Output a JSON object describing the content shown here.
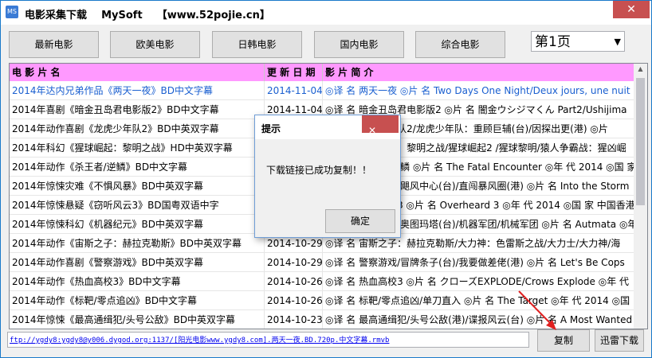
{
  "window": {
    "title": "电影采集下载    MySoft    【www.52pojie.cn】",
    "icon": "MS"
  },
  "nav": {
    "latest": "最新电影",
    "western": "欧美电影",
    "japan_korea": "日韩电影",
    "domestic": "国内电影",
    "general": "综合电影",
    "page": "第1页"
  },
  "table": {
    "columns": [
      "电 影 片 名",
      "更 新 日 期",
      "影 片 简 介"
    ],
    "rows": [
      [
        "2014年达内兄弟作品《两天一夜》BD中文字幕",
        "2014-11-04",
        "◎译 名 两天一夜 ◎片 名 Two Days One Night/Deux jours, une nuit"
      ],
      [
        "2014年喜剧《暗金丑岛君电影版2》BD中文字幕",
        "2014-11-04",
        "◎译 名 暗金丑岛君电影版2 ◎片 名 闇金ウシジマくん Part2/Ushijima"
      ],
      [
        "2014年动作喜剧《龙虎少年队2》BD中英双字幕",
        "2014-11-03",
        "◎译 名 龙虎少年队2/龙虎少年队：重顾巨辅(台)/因探出更(港) ◎片"
      ],
      [
        "2014年科幻《猩球崛起：黎明之战》HD中英双字幕",
        "2014-11-02",
        "◎译 名 猩球崛起：黎明之战/猩球崛起2 /猩球黎明/猿人争霸战：猩凶崛"
      ],
      [
        "2014年动作《杀王者/逆鳞》BD中文字幕",
        "2014-11-01",
        "◎译 名 杀王者/逆鳞 ◎片 名 The Fatal Encounter ◎年 代 2014 ◎国 家"
      ],
      [
        "2014年惊悚灾难《不惧风暴》BD中英双字幕",
        "2014-10-31",
        "◎译 名 不惧风暴/飓风中心(台)/直闯暴风圈(港) ◎片 名 Into the Storm"
      ],
      [
        "2014年惊悚悬疑《窃听风云3》BD国粤双语中字",
        "2014-10-30",
        "◎译 名 窃听风云3 ◎片 名 Overheard 3 ◎年 代 2014 ◎国 家 中国香港"
      ],
      [
        "2014年惊悚科幻《机器纪元》BD中英双字幕",
        "2014-10-30",
        "◎译 名 机器纪元/奥图玛塔(台)/机器军团/机械军团 ◎片 名 Autmata ◎年"
      ],
      [
        "2014年动作《宙斯之子：赫拉克勒斯》BD中英双字幕",
        "2014-10-29",
        "◎译 名 宙斯之子：赫拉克勒斯/大力神：色雷斯之战/大力士/大力神/海"
      ],
      [
        "2014年动作喜剧《警察游戏》BD中英双字幕",
        "2014-10-29",
        "◎译 名 警察游戏/冒牌条子(台)/我要做差佬(港) ◎片 名 Let's Be Cops"
      ],
      [
        "2014年动作《热血高校3》BD中文字幕",
        "2014-10-26",
        "◎译 名 热血高校3 ◎片 名 クローズEXPLODE/Crows Explode ◎年 代"
      ],
      [
        "2014年动作《标靶/零点追凶》BD中文字幕",
        "2014-10-26",
        "◎译 名 标靶/零点追凶/单刀直入 ◎片 名 The Target ◎年 代 2014 ◎国"
      ],
      [
        "2014年惊悚《最高通缉犯/头号公敌》BD中英双字幕",
        "2014-10-23",
        "◎译 名 最高通缉犯/头号公敌(港)/谍报风云(台) ◎片 名 A Most Wanted"
      ]
    ]
  },
  "footer": {
    "link": "ftp://ygdy8:ygdy8@y006.dygod.org:1137/[阳光电影www.ygdy8.com].两天一夜.BD.720p.中文字幕.rmvb",
    "copy_label": "复制",
    "thunder_label": "迅雷下载"
  },
  "dialog": {
    "title": "提示",
    "message": "下载链接已成功复制！！",
    "ok_label": "确定"
  },
  "colors": {
    "header_bg": "#ff99ff",
    "selected_text": "#1a5fd0",
    "close_red": "#c75050",
    "arrow": "#e02020"
  }
}
